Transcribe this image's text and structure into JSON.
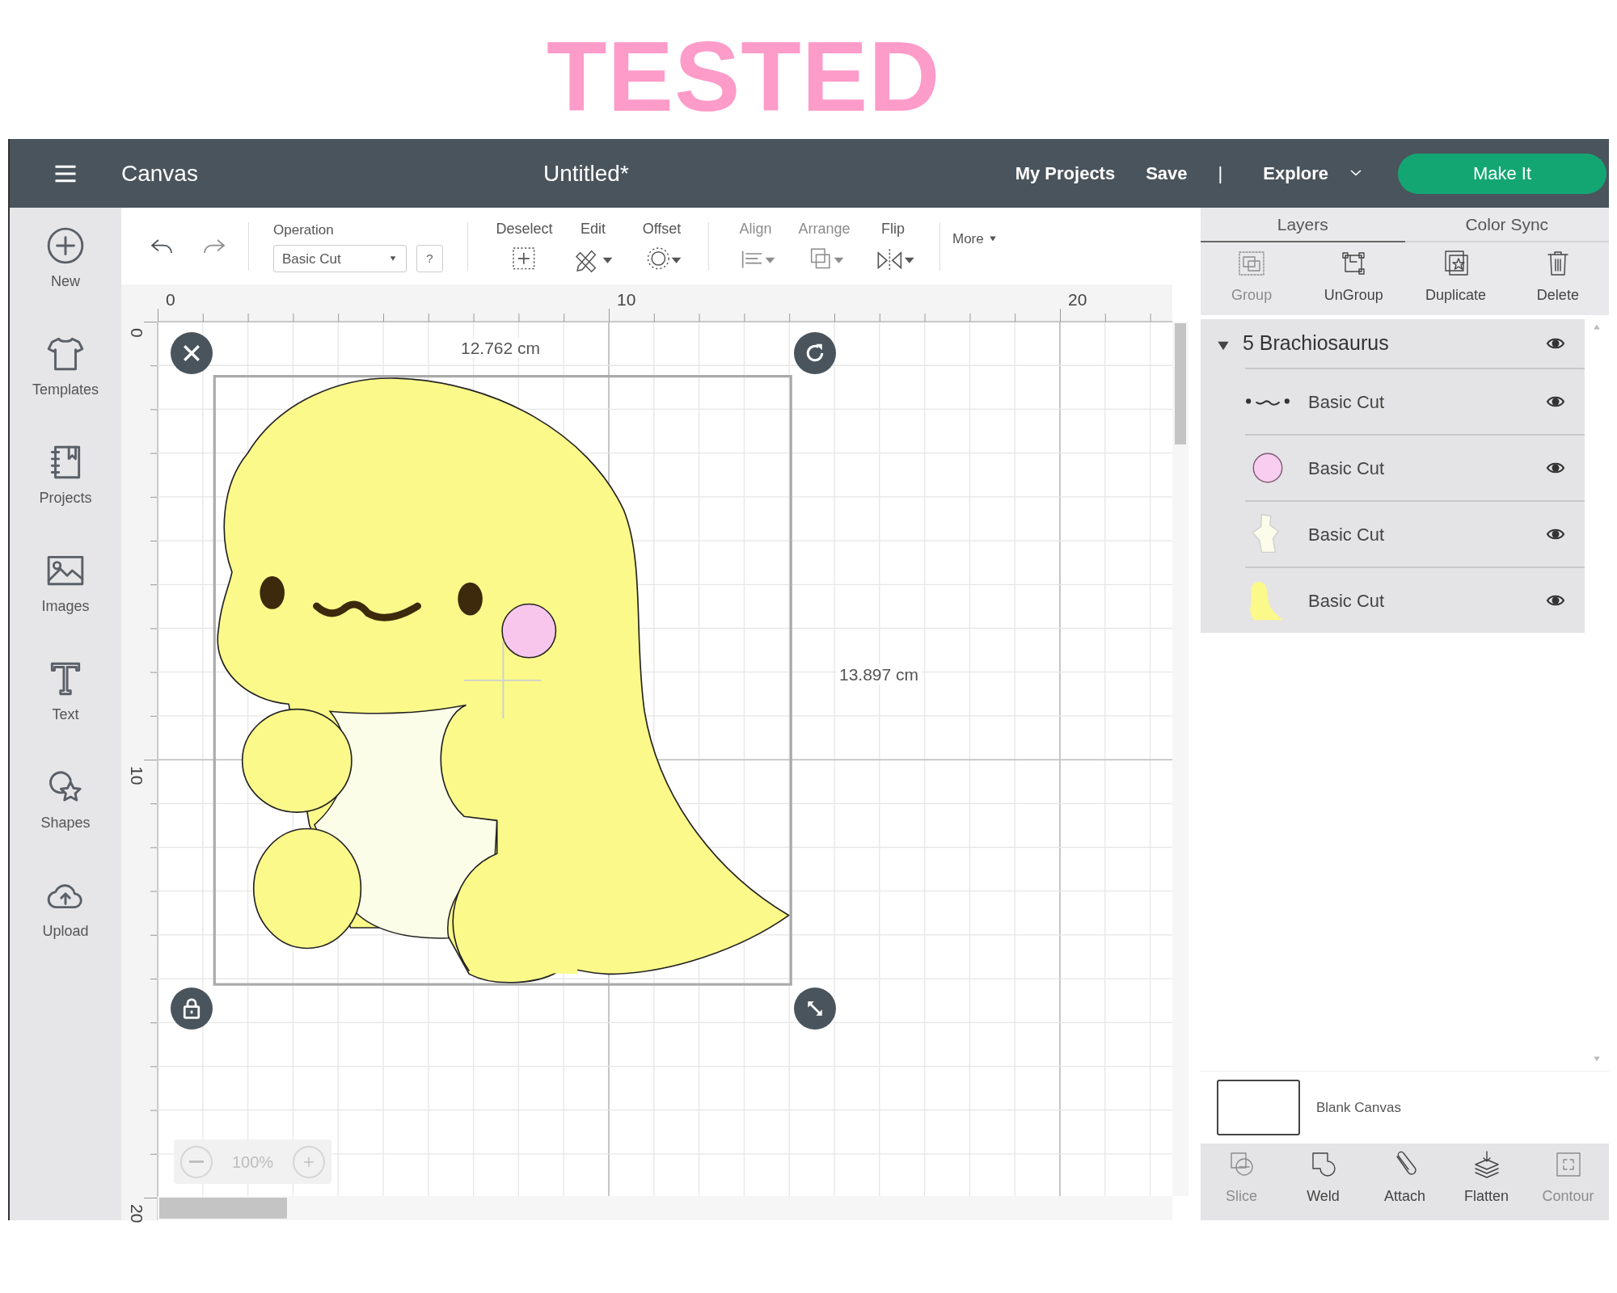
{
  "banner": {
    "text": "TESTED"
  },
  "header": {
    "title": "Canvas",
    "document": "Untitled*",
    "links": [
      "My Projects",
      "Save"
    ],
    "separator": "|",
    "explore": "Explore",
    "action": "Make It"
  },
  "sidebar": {
    "items": [
      {
        "label": "New",
        "kind": "new"
      },
      {
        "label": "Templates",
        "kind": "templates"
      },
      {
        "label": "Projects",
        "kind": "projects"
      },
      {
        "label": "Images",
        "kind": "images"
      },
      {
        "label": "Text",
        "kind": "text"
      },
      {
        "label": "Shapes",
        "kind": "shapes"
      },
      {
        "label": "Upload",
        "kind": "upload"
      }
    ]
  },
  "toolbar": {
    "undo": {
      "disabled": false
    },
    "redo": {
      "disabled": true
    },
    "operation": {
      "label": "Operation",
      "value": "Basic Cut",
      "help": "?"
    },
    "tools": [
      {
        "label": "Deselect",
        "kind": "deselect",
        "disabled": false
      },
      {
        "label": "Edit",
        "kind": "edit",
        "disabled": false
      },
      {
        "label": "Offset",
        "kind": "offset",
        "disabled": false
      },
      {
        "label": "Align",
        "kind": "align",
        "disabled": true
      },
      {
        "label": "Arrange",
        "kind": "arrange",
        "disabled": true
      },
      {
        "label": "Flip",
        "kind": "flip",
        "disabled": false
      }
    ],
    "more": "More"
  },
  "rulers": {
    "horizontal": [
      "0",
      "10",
      "20"
    ],
    "vertical": [
      "0",
      "10",
      "20"
    ]
  },
  "canvas": {
    "width_label": "12.762 cm",
    "height_label": "13.897 cm",
    "zoom": "100%"
  },
  "panel": {
    "tabs": [
      {
        "label": "Layers",
        "selected": true
      },
      {
        "label": "Color Sync",
        "selected": false
      }
    ],
    "actions": [
      {
        "label": "Group",
        "kind": "group",
        "disabled": true
      },
      {
        "label": "UnGroup",
        "kind": "ungroup",
        "disabled": false
      },
      {
        "label": "Duplicate",
        "kind": "duplicate",
        "disabled": false
      },
      {
        "label": "Delete",
        "kind": "delete",
        "disabled": false
      }
    ],
    "layer_group": {
      "name": "5 Brachiosaurus",
      "expanded": true,
      "visible": true,
      "children": [
        {
          "name": "Basic Cut",
          "kind": "face",
          "visible": true
        },
        {
          "name": "Basic Cut",
          "kind": "cheek",
          "visible": true
        },
        {
          "name": "Basic Cut",
          "kind": "belly",
          "visible": true
        },
        {
          "name": "Basic Cut",
          "kind": "body",
          "visible": true
        }
      ]
    },
    "blank_canvas": {
      "label": "Blank Canvas"
    },
    "bottom_tools": [
      {
        "label": "Slice",
        "kind": "slice",
        "disabled": true
      },
      {
        "label": "Weld",
        "kind": "weld",
        "disabled": false
      },
      {
        "label": "Attach",
        "kind": "attach",
        "disabled": false
      },
      {
        "label": "Flatten",
        "kind": "flatten",
        "disabled": false
      },
      {
        "label": "Contour",
        "kind": "contour",
        "disabled": true
      }
    ]
  }
}
